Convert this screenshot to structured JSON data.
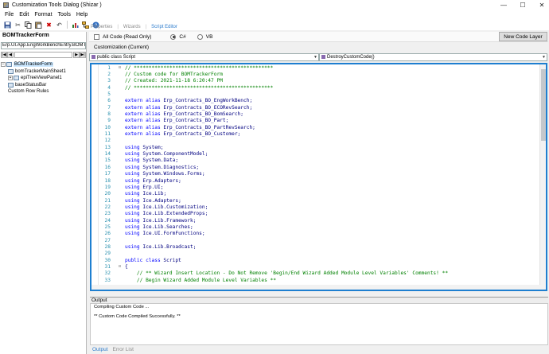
{
  "window": {
    "title": "Customization Tools Dialog  (Shizar )"
  },
  "menu": [
    "File",
    "Edit",
    "Format",
    "Tools",
    "Help"
  ],
  "toolbar_icons": [
    "save-icon",
    "cut-icon",
    "copy-icon",
    "paste-icon",
    "delete-icon",
    "undo-icon",
    "separator",
    "chart-icon",
    "tree-icon",
    "help-icon"
  ],
  "left": {
    "header": "BOMTrackerForm",
    "form_combo": "Erp.UI.App.EngWorkBenchEntry.BOMTra",
    "tree": [
      {
        "label": "BOMTrackerForm",
        "expander": "−",
        "selected": true
      },
      {
        "label": "bomTrackerMainSheet1",
        "expander": ""
      },
      {
        "label": "epiTreeViewPanel1",
        "expander": "+"
      },
      {
        "label": "baseStatusBar",
        "expander": ""
      },
      {
        "label": "Custom Row Rules",
        "expander": ""
      }
    ]
  },
  "tabs": [
    {
      "label": "Properties",
      "active": false
    },
    {
      "label": "Wizards",
      "active": false
    },
    {
      "label": "Script Editor",
      "active": true
    }
  ],
  "options": {
    "all_code_label": "All Code (Read Only)",
    "radio_csharp": "C#",
    "radio_vb": "VB",
    "new_layer_button": "New Code Layer",
    "customization_label": "Customization (Current)"
  },
  "combos": {
    "class_combo": "public class Script",
    "member_combo": "DestroyCustomCode()"
  },
  "code_lines": [
    {
      "n": "1",
      "t": "// ***********************************************",
      "c": "cm",
      "fold": "-"
    },
    {
      "n": "2",
      "t": "// Custom code for BOMTrackerForm",
      "c": "cm"
    },
    {
      "n": "3",
      "t": "// Created: 2021-11-18 6:20:47 PM",
      "c": "cm"
    },
    {
      "n": "4",
      "t": "// ***********************************************",
      "c": "cm"
    },
    {
      "n": "5",
      "t": "",
      "c": "tx"
    },
    {
      "n": "6",
      "t": "extern alias Erp_Contracts_BO_EngWorkBench;",
      "c": "mix",
      "kw": "extern alias"
    },
    {
      "n": "7",
      "t": "extern alias Erp_Contracts_BO_ECORevSearch;",
      "c": "mix",
      "kw": "extern alias"
    },
    {
      "n": "8",
      "t": "extern alias Erp_Contracts_BO_BomSearch;",
      "c": "mix",
      "kw": "extern alias"
    },
    {
      "n": "9",
      "t": "extern alias Erp_Contracts_BO_Part;",
      "c": "mix",
      "kw": "extern alias"
    },
    {
      "n": "10",
      "t": "extern alias Erp_Contracts_BO_PartRevSearch;",
      "c": "mix",
      "kw": "extern alias"
    },
    {
      "n": "11",
      "t": "extern alias Erp_Contracts_BO_Customer;",
      "c": "mix",
      "kw": "extern alias"
    },
    {
      "n": "12",
      "t": "",
      "c": "tx"
    },
    {
      "n": "13",
      "t": "using System;",
      "c": "mix",
      "kw": "using"
    },
    {
      "n": "14",
      "t": "using System.ComponentModel;",
      "c": "mix",
      "kw": "using"
    },
    {
      "n": "15",
      "t": "using System.Data;",
      "c": "mix",
      "kw": "using"
    },
    {
      "n": "16",
      "t": "using System.Diagnostics;",
      "c": "mix",
      "kw": "using"
    },
    {
      "n": "17",
      "t": "using System.Windows.Forms;",
      "c": "mix",
      "kw": "using"
    },
    {
      "n": "18",
      "t": "using Erp.Adapters;",
      "c": "mix",
      "kw": "using"
    },
    {
      "n": "19",
      "t": "using Erp.UI;",
      "c": "mix",
      "kw": "using"
    },
    {
      "n": "20",
      "t": "using Ice.Lib;",
      "c": "mix",
      "kw": "using"
    },
    {
      "n": "21",
      "t": "using Ice.Adapters;",
      "c": "mix",
      "kw": "using"
    },
    {
      "n": "22",
      "t": "using Ice.Lib.Customization;",
      "c": "mix",
      "kw": "using"
    },
    {
      "n": "23",
      "t": "using Ice.Lib.ExtendedProps;",
      "c": "mix",
      "kw": "using"
    },
    {
      "n": "24",
      "t": "using Ice.Lib.Framework;",
      "c": "mix",
      "kw": "using"
    },
    {
      "n": "25",
      "t": "using Ice.Lib.Searches;",
      "c": "mix",
      "kw": "using"
    },
    {
      "n": "26",
      "t": "using Ice.UI.FormFunctions;",
      "c": "mix",
      "kw": "using"
    },
    {
      "n": "27",
      "t": "",
      "c": "tx"
    },
    {
      "n": "28",
      "t": "using Ice.Lib.Broadcast;",
      "c": "mix",
      "kw": "using"
    },
    {
      "n": "29",
      "t": "",
      "c": "tx"
    },
    {
      "n": "30",
      "t": "public class Script",
      "c": "mix",
      "kw": "public class"
    },
    {
      "n": "31",
      "t": "{",
      "c": "tx",
      "fold": "-"
    },
    {
      "n": "32",
      "t": "    // ** Wizard Insert Location - Do Not Remove 'Begin/End Wizard Added Module Level Variables' Comments! **",
      "c": "cm"
    },
    {
      "n": "33",
      "t": "    // Begin Wizard Added Module Level Variables **",
      "c": "cm"
    }
  ],
  "output": {
    "header": "Output",
    "lines": [
      "Compiling Custom Code ...",
      "",
      "** Custom Code Compiled Successfully. **"
    ]
  },
  "bottom_tabs": [
    {
      "label": "Output",
      "active": true
    },
    {
      "label": "Error List",
      "active": false
    }
  ]
}
